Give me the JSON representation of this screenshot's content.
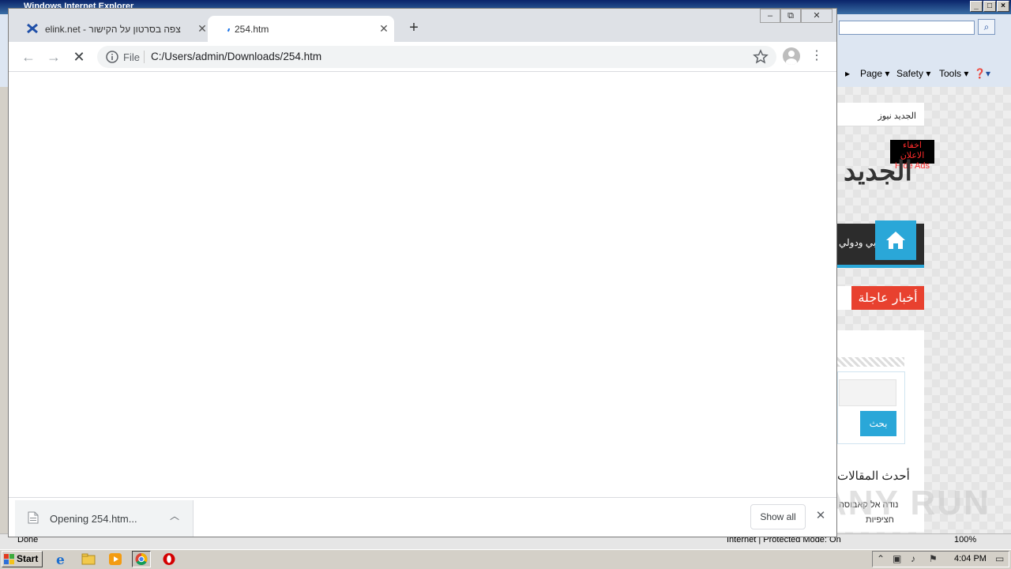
{
  "ie": {
    "title": "Windows Internet Explorer",
    "menu": [
      "Page",
      "Safety",
      "Tools"
    ],
    "status_done": "Done",
    "status_zone": "Internet | Protected Mode: On",
    "zoom": "100%"
  },
  "site": {
    "top_link": "الجديد نيوز",
    "hide_ads": [
      "اخفاء الاعلان",
      "Hide Ads"
    ],
    "logo": "الجديد",
    "nav_item": "عربي ودولي",
    "breaking": "أخبار عاجلة",
    "search_button": "بحث",
    "latest_heading": "أحدث المقالات",
    "article_line1": "נודה אל קאבוסה",
    "article_line2": "חציפיות",
    "watermark": "ANY RUN"
  },
  "chrome": {
    "tabs": [
      {
        "title": "צפה בסרטון על הקישור - elink.net"
      },
      {
        "title": "254.htm"
      }
    ],
    "new_tab": "+",
    "file_chip": "File",
    "url": "C:/Users/admin/Downloads/254.htm",
    "download": {
      "name": "Opening 254.htm...",
      "show_all": "Show all"
    }
  },
  "taskbar": {
    "start": "Start",
    "clock": "4:04 PM"
  }
}
